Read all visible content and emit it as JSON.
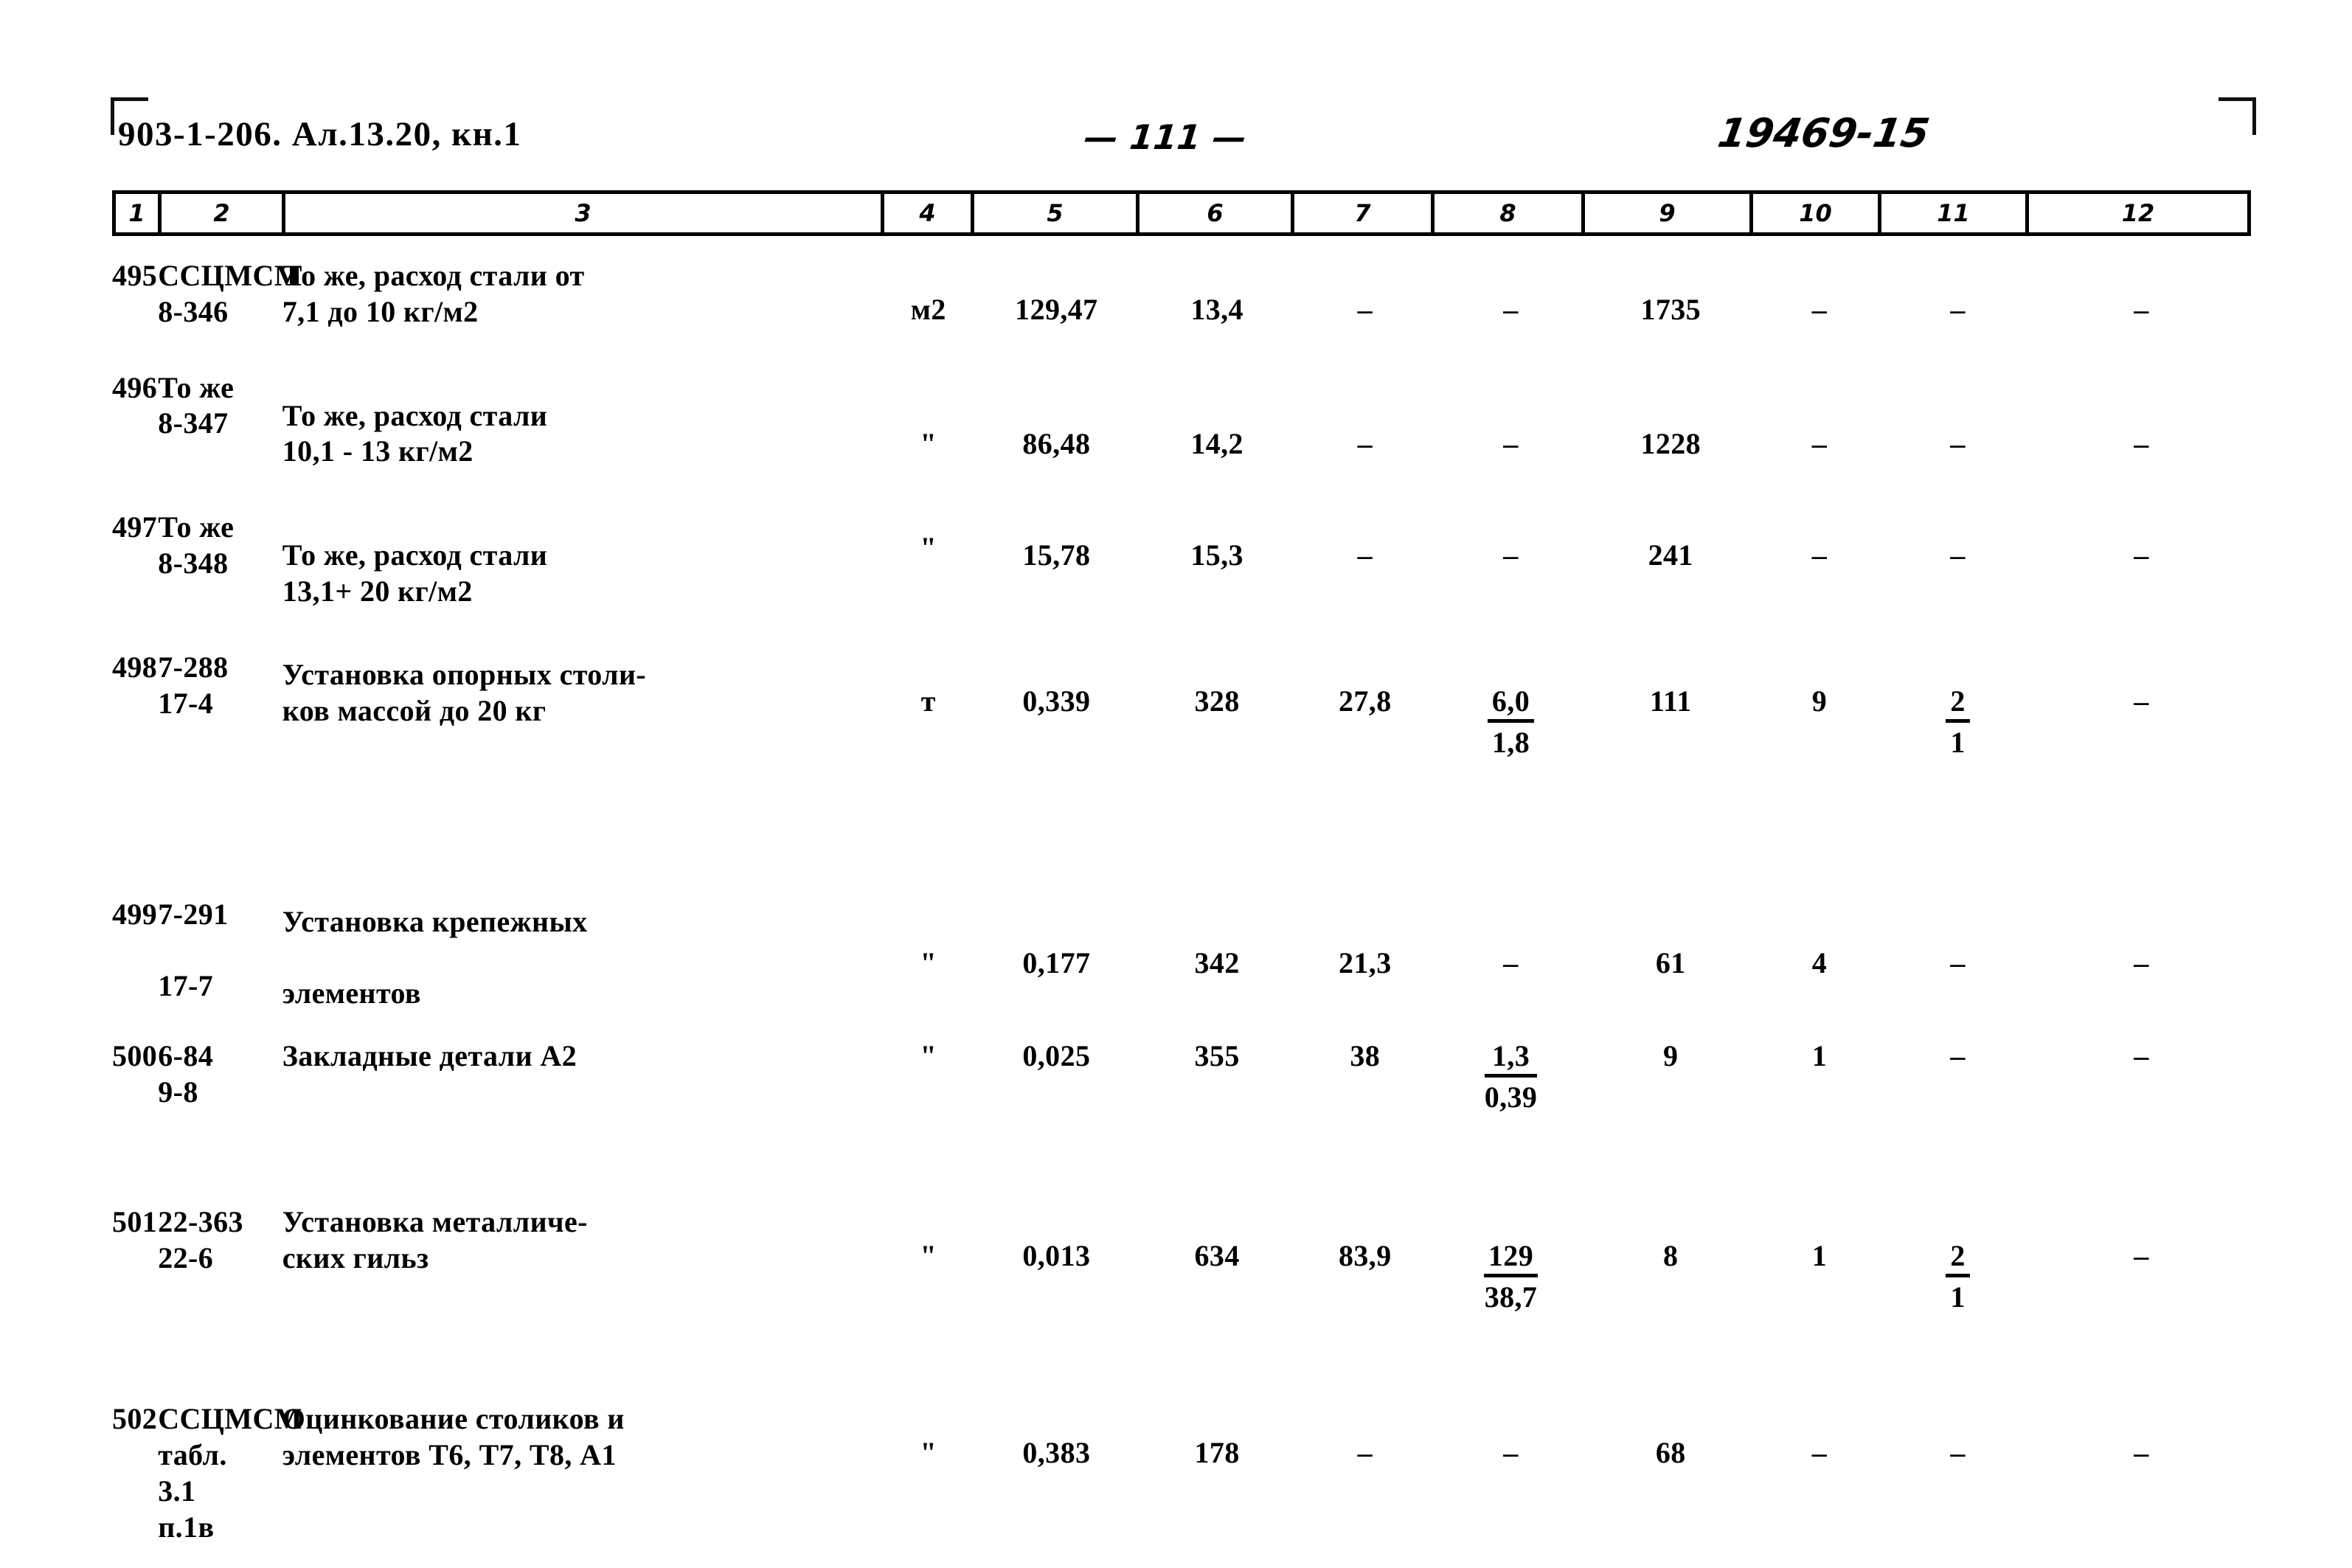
{
  "header": {
    "doc_code": "903-1-206. Ал.13.20, кн.1",
    "page_number": "— 111 —",
    "archive_number": "19469-15"
  },
  "column_headers": [
    "1",
    "2",
    "3",
    "4",
    "5",
    "6",
    "7",
    "8",
    "9",
    "10",
    "11",
    "12"
  ],
  "rows": [
    {
      "num": "495",
      "code_line1": "ССЦМСМ",
      "code_line2": "8-346",
      "desc_line1": "То же, расход стали от",
      "desc_line2": "7,1 до 10 кг/м2",
      "unit": "м2",
      "c5": "129,47",
      "c6": "13,4",
      "c7": "–",
      "c8": "–",
      "c8_denom": "",
      "c9": "1735",
      "c10": "–",
      "c11": "–",
      "c11_denom": "",
      "c12": "–"
    },
    {
      "num": "496",
      "code_line1": "То же",
      "code_line2": "8-347",
      "desc_line1": "То же, расход стали",
      "desc_line2": "10,1 - 13 кг/м2",
      "unit": "\"",
      "c5": "86,48",
      "c6": "14,2",
      "c7": "–",
      "c8": "–",
      "c8_denom": "",
      "c9": "1228",
      "c10": "–",
      "c11": "–",
      "c11_denom": "",
      "c12": "–"
    },
    {
      "num": "497",
      "code_line1": "То же",
      "code_line2": "8-348",
      "desc_line1": "То же, расход стали",
      "desc_line2": "13,1+ 20 кг/м2",
      "unit": "\"",
      "c5": "15,78",
      "c6": "15,3",
      "c7": "–",
      "c8": "–",
      "c8_denom": "",
      "c9": "241",
      "c10": "–",
      "c11": "–",
      "c11_denom": "",
      "c12": "–"
    },
    {
      "num": "498",
      "code_line1": "7-288",
      "code_line2": "17-4",
      "desc_line1": "Установка опорных столи-",
      "desc_line2": "ков массой до 20 кг",
      "unit": "т",
      "c5": "0,339",
      "c6": "328",
      "c7": "27,8",
      "c8": "6,0",
      "c8_denom": "1,8",
      "c9": "111",
      "c10": "9",
      "c11": "2",
      "c11_denom": "1",
      "c12": "–"
    },
    {
      "num": "499",
      "code_line1": "7-291",
      "code_line2": "17-7",
      "desc_line1": "Установка крепежных",
      "desc_line2": "элементов",
      "unit": "\"",
      "c5": "0,177",
      "c6": "342",
      "c7": "21,3",
      "c8": "–",
      "c8_denom": "",
      "c9": "61",
      "c10": "4",
      "c11": "–",
      "c11_denom": "",
      "c12": "–"
    },
    {
      "num": "500",
      "code_line1": "6-84",
      "code_line2": "9-8",
      "desc_line1": "Закладные детали А2",
      "desc_line2": "",
      "unit": "\"",
      "c5": "0,025",
      "c6": "355",
      "c7": "38",
      "c8": "1,3",
      "c8_denom": "0,39",
      "c9": "9",
      "c10": "1",
      "c11": "–",
      "c11_denom": "",
      "c12": "–"
    },
    {
      "num": "501",
      "code_line1": "22-363",
      "code_line2": "22-6",
      "desc_line1": "Установка металличе-",
      "desc_line2": "ских гильз",
      "unit": "\"",
      "c5": "0,013",
      "c6": "634",
      "c7": "83,9",
      "c8": "129",
      "c8_denom": "38,7",
      "c9": "8",
      "c10": "1",
      "c11": "2",
      "c11_denom": "1",
      "c12": "–"
    },
    {
      "num": "502",
      "code_line1": "ССЦМСМ",
      "code_line2": "табл.",
      "code_line3": "3.1",
      "code_line4": "п.1в",
      "desc_line1": "Оцинкование столиков и",
      "desc_line2": "элементов Т6, Т7, Т8, А1",
      "unit": "\"",
      "c5": "0,383",
      "c6": "178",
      "c7": "–",
      "c8": "–",
      "c8_denom": "",
      "c9": "68",
      "c10": "–",
      "c11": "–",
      "c11_denom": "",
      "c12": "–"
    }
  ]
}
